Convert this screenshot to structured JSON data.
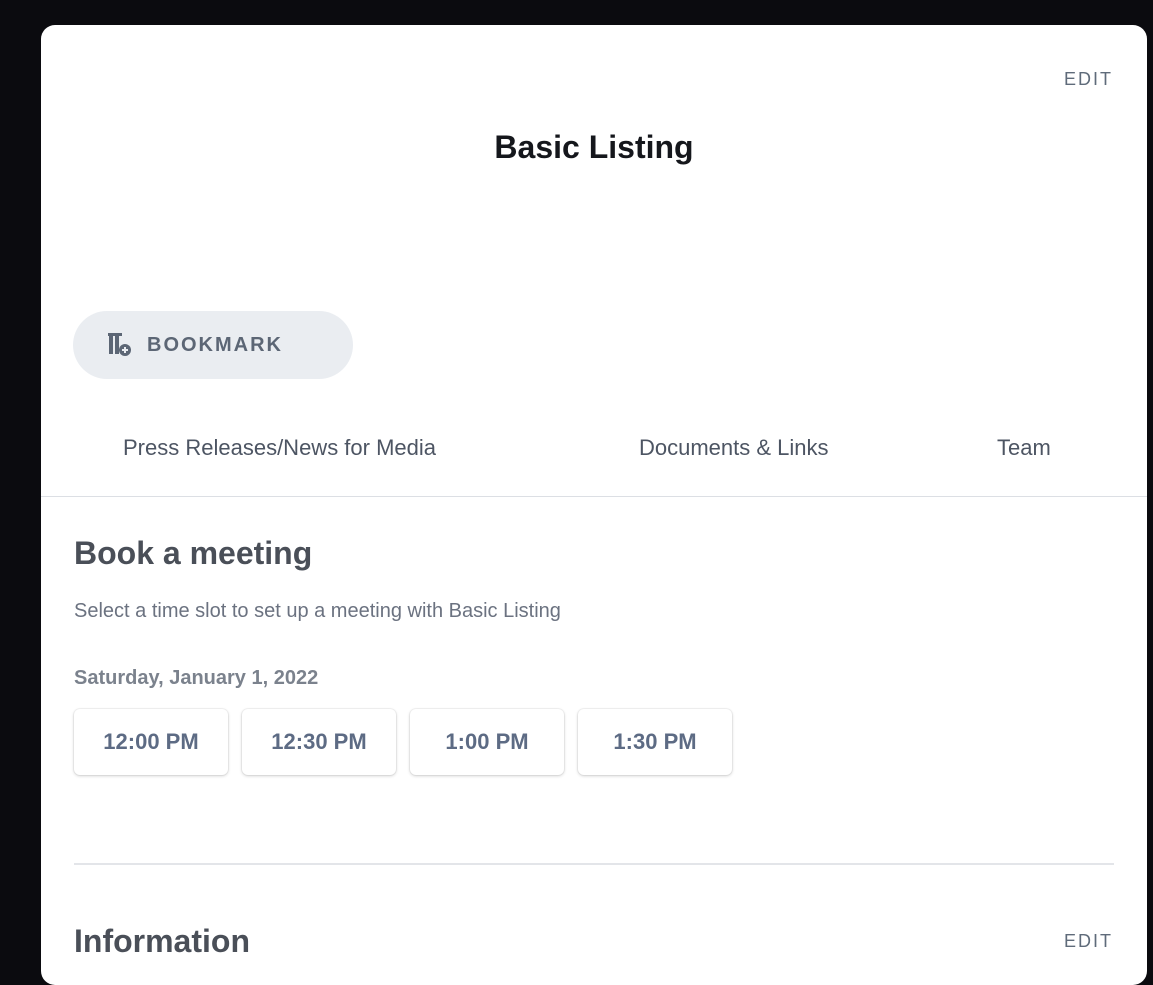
{
  "header": {
    "edit_label": "EDIT",
    "title": "Basic Listing"
  },
  "bookmark": {
    "label": "BOOKMARK",
    "icon": "bookmark-add-icon"
  },
  "tabs": [
    {
      "label": "Press Releases/News for Media"
    },
    {
      "label": "Documents & Links"
    },
    {
      "label": "Team"
    }
  ],
  "meeting": {
    "title": "Book a meeting",
    "subtitle": "Select a time slot to set up a meeting with Basic Listing",
    "date": "Saturday, January 1, 2022",
    "slots": [
      "12:00 PM",
      "12:30 PM",
      "1:00 PM",
      "1:30 PM"
    ]
  },
  "information": {
    "title": "Information",
    "edit_label": "EDIT"
  },
  "colors": {
    "background": "#0b0b0f",
    "card": "#ffffff",
    "bookmark_bg": "#eaedf1",
    "slot_text": "#5d6b84"
  }
}
